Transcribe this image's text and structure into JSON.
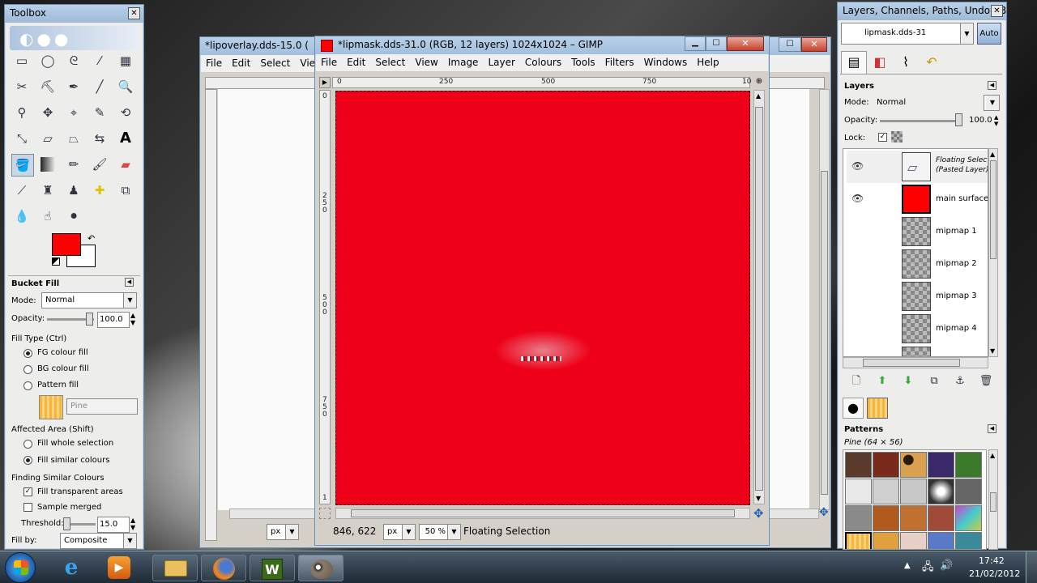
{
  "toolbox": {
    "title": "Toolbox",
    "tool_options_title": "Bucket Fill",
    "mode_label": "Mode:",
    "mode_value": "Normal",
    "opacity_label": "Opacity:",
    "opacity_value": "100.0",
    "fill_type_label": "Fill Type  (Ctrl)",
    "fill_types": [
      "FG colour fill",
      "BG colour fill",
      "Pattern fill"
    ],
    "pattern_name": "Pine",
    "affected_area_label": "Affected Area  (Shift)",
    "affected_options": [
      "Fill whole selection",
      "Fill similar colours"
    ],
    "finding_label": "Finding Similar Colours",
    "fill_transparent": "Fill transparent areas",
    "sample_merged": "Sample merged",
    "threshold_label": "Threshold:",
    "threshold_value": "15.0",
    "fillby_label": "Fill by:",
    "fillby_value": "Composite",
    "colors": {
      "fg": "#ff0000",
      "bg": "#ffffff"
    }
  },
  "back_window": {
    "title": "*lipoverlay.dds-15.0 (",
    "menu": [
      "File",
      "Edit",
      "Select",
      "Vie"
    ],
    "unit": "px"
  },
  "main_window": {
    "title": "*lipmask.dds-31.0 (RGB, 12 layers) 1024x1024 – GIMP",
    "menu": [
      "File",
      "Edit",
      "Select",
      "View",
      "Image",
      "Layer",
      "Colours",
      "Tools",
      "Filters",
      "Windows",
      "Help"
    ],
    "hruler": [
      "0",
      "250",
      "500",
      "750",
      "10"
    ],
    "vruler": [
      "0",
      "2\n5\n0",
      "5\n0\n0",
      "7\n5\n0",
      "1"
    ],
    "canvas_color": "#ee0019",
    "coords": "846, 622",
    "unit": "px",
    "zoom": "50 %",
    "status": "Floating Selection"
  },
  "dock": {
    "title": "Layers, Channels, Paths, Undo - B...",
    "image_name": "lipmask.dds-31",
    "auto_label": "Auto",
    "layers_title": "Layers",
    "mode_label": "Mode:",
    "mode_value": "Normal",
    "opacity_label": "Opacity:",
    "opacity_value": "100.0",
    "lock_label": "Lock:",
    "layers": [
      {
        "name": "Floating Selection\n(Pasted Layer)",
        "italic": true
      },
      {
        "name": "main surface",
        "italic": false
      },
      {
        "name": "mipmap 1",
        "italic": false
      },
      {
        "name": "mipmap 2",
        "italic": false
      },
      {
        "name": "mipmap 3",
        "italic": false
      },
      {
        "name": "mipmap 4",
        "italic": false
      }
    ],
    "patterns_title": "Patterns",
    "patterns_sub": "Pine  (64 × 56)"
  },
  "taskbar": {
    "time": "17:42",
    "date": "21/02/2012"
  }
}
